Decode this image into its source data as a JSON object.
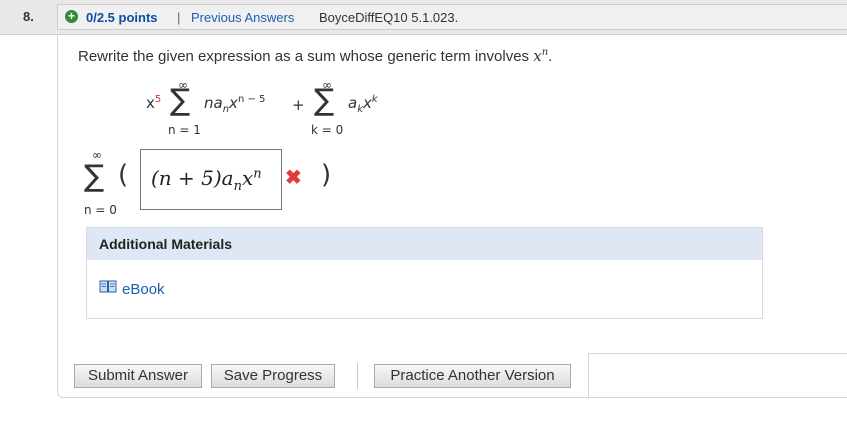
{
  "header": {
    "question_number": "8.",
    "points": "0/2.5 points",
    "separator": "|",
    "previous_answers": "Previous Answers",
    "problem_code": "BoyceDiffEQ10 5.1.023."
  },
  "question": {
    "prompt_text": "Rewrite the given expression as a sum whose generic term involves ",
    "prompt_var": "x",
    "prompt_sup": "n",
    "prompt_end": ".",
    "expr1_coef": "x",
    "expr1_coef_sup": "5",
    "expr1_upper": "∞",
    "expr1_lower": "n = 1",
    "expr1_term": "na",
    "expr1_sub": "n",
    "expr1_x": "x",
    "expr1_exp": "n − 5",
    "plus": "+",
    "expr2_upper": "∞",
    "expr2_lower": "k = 0",
    "expr2_term": "a",
    "expr2_sub": "k",
    "expr2_x": "x",
    "expr2_exp": "k",
    "answer_upper": "∞",
    "answer_lower": "n = 0",
    "answer_value": "(n + 5)a",
    "answer_sub": "n",
    "answer_x": "x",
    "answer_sup": "n"
  },
  "materials": {
    "title": "Additional Materials",
    "ebook_label": "eBook"
  },
  "buttons": {
    "submit": "Submit Answer",
    "save": "Save Progress",
    "practice": "Practice Another Version"
  },
  "colors": {
    "incorrect": "#e23b3b",
    "link": "#1a5fb4",
    "correct_icon": "#2e8b3d"
  }
}
